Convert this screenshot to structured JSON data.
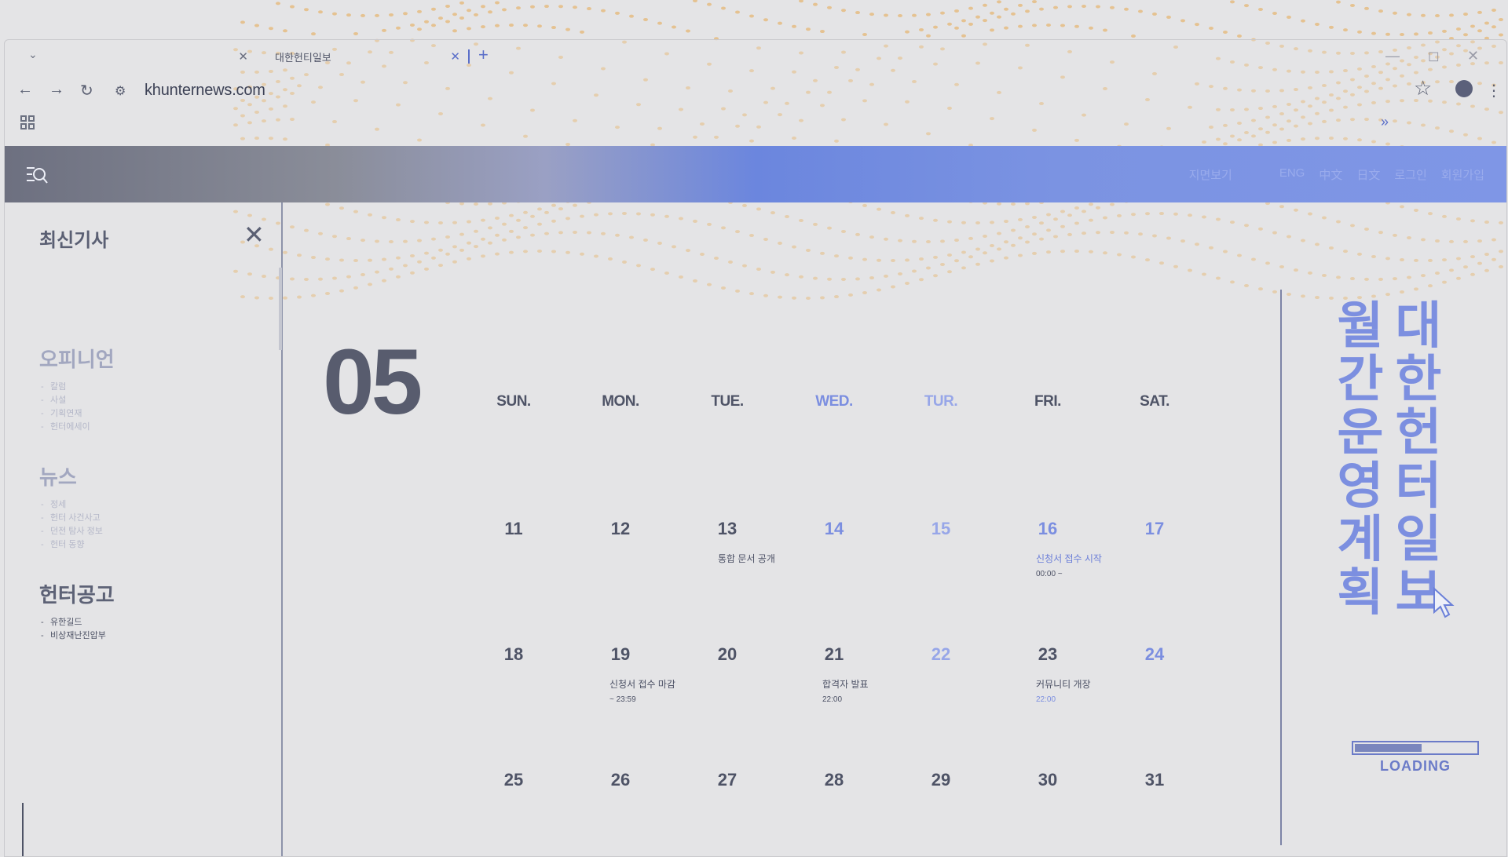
{
  "browser": {
    "tabs": [
      {
        "title": ""
      },
      {
        "title": "대한헌티일보"
      }
    ],
    "new_tab_label": "+",
    "url": "khunternews.com",
    "controls": {
      "minimize": "—",
      "maximize": "◻",
      "close": "✕"
    },
    "bookmarks_more": "»"
  },
  "header": {
    "nav": [
      "지면보기",
      "ENG",
      "中文",
      "日文",
      "로그인",
      "회원가입"
    ]
  },
  "sidebar": {
    "title": "최신기사",
    "sections": [
      {
        "title": "오피니언",
        "items": [
          "칼럼",
          "사설",
          "기획연재",
          "헌터에세이"
        ]
      },
      {
        "title": "뉴스",
        "items": [
          "정세",
          "헌터 사건사고",
          "던전 탐사 정보",
          "헌터 동향"
        ]
      },
      {
        "title": "헌터공고",
        "items": [
          "유한길드",
          "비상재난진압부"
        ]
      }
    ]
  },
  "calendar": {
    "month": "05",
    "weekdays": [
      "SUN.",
      "MON.",
      "TUE.",
      "WED.",
      "TUR.",
      "FRI.",
      "SAT."
    ],
    "weeks": [
      [
        "11",
        "12",
        "13",
        "14",
        "15",
        "16",
        "17"
      ],
      [
        "18",
        "19",
        "20",
        "21",
        "22",
        "23",
        "24"
      ],
      [
        "25",
        "26",
        "27",
        "28",
        "29",
        "30",
        "31"
      ]
    ],
    "events": {
      "e13": {
        "title": "통합 문서 공개",
        "time": ""
      },
      "e16": {
        "title": "신청서 접수 시작",
        "time": "00:00 ~"
      },
      "e19": {
        "title": "신청서 접수 마감",
        "time": "~ 23:59"
      },
      "e21": {
        "title": "합격자 발표",
        "time": "22:00"
      },
      "e23": {
        "title": "커뮤니티 개장",
        "time": "22:00"
      }
    }
  },
  "side_panel": {
    "title_col1": "대한헌터일보",
    "title_col2": "월간운영계획",
    "loading": "LOADING",
    "loading_progress": 0.55
  },
  "colors": {
    "accent": "#7b8ee0",
    "text": "#4e5366",
    "dots": "#e6a54a"
  }
}
